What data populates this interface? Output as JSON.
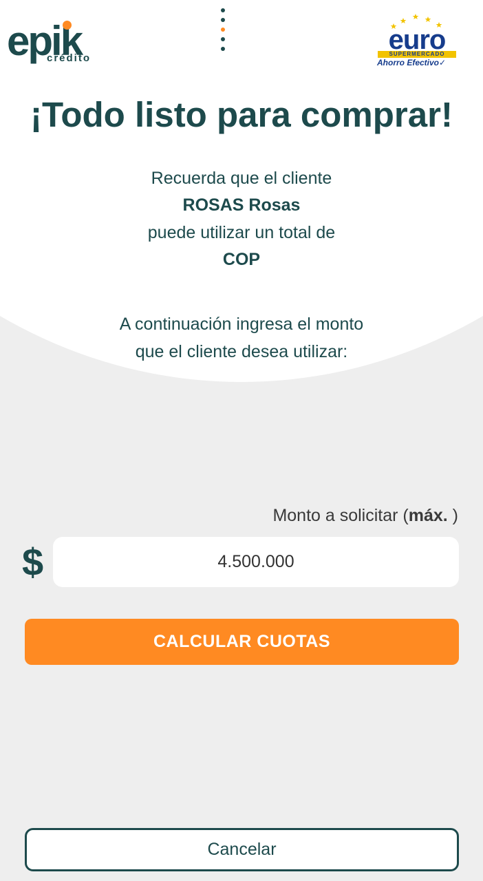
{
  "header": {
    "brand_left": {
      "word": "epik",
      "sub": "crédito"
    },
    "brand_right": {
      "word": "euro",
      "bar": "SUPERMERCADO",
      "tagline": "Ahorro Efectivo"
    },
    "menu_icon": "vertical-dots-icon"
  },
  "title": "¡Todo listo para comprar!",
  "info": {
    "line1": "Recuerda que el cliente",
    "client_name": "ROSAS Rosas",
    "line3": "puede utilizar un total de",
    "currency_code": "COP",
    "instruction_line1": "A continuación ingresa el monto",
    "instruction_line2": "que el cliente desea utilizar:"
  },
  "form": {
    "amount_label_prefix": "Monto a solicitar (",
    "amount_label_bold": "máx.",
    "amount_label_suffix": " )",
    "currency_symbol": "$",
    "amount_value": "4.500.000"
  },
  "actions": {
    "calculate_label": "CALCULAR CUOTAS",
    "cancel_label": "Cancelar"
  },
  "colors": {
    "primary": "#1d4a4c",
    "accent": "#ff8a22",
    "background": "#eeeeee",
    "brand_blue": "#163c8c",
    "brand_yellow": "#f2c300"
  }
}
